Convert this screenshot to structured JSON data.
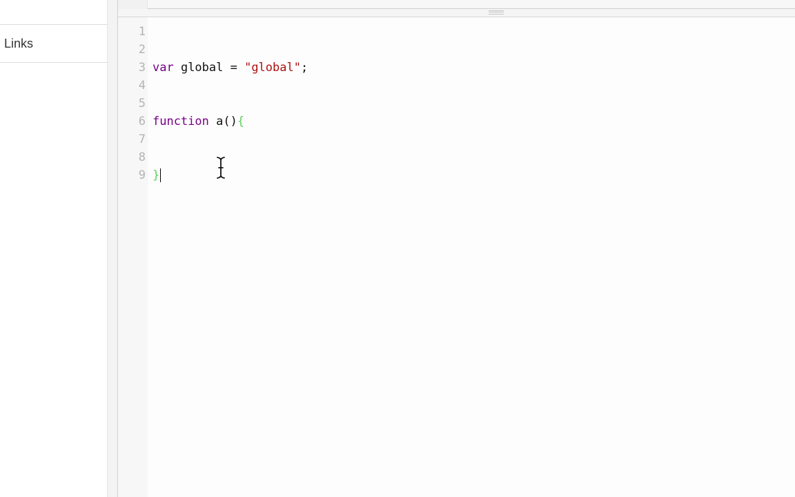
{
  "sidebar": {
    "items": [
      {
        "label": "Links"
      }
    ]
  },
  "editor": {
    "line_numbers": [
      "1",
      "2",
      "3",
      "4",
      "5",
      "6",
      "7",
      "8",
      "9"
    ],
    "line3": {
      "keyword": "var",
      "ident": " global = ",
      "string": "\"global\"",
      "end": ";"
    },
    "line6": {
      "keyword": "function",
      "ident": " a()",
      "brace": "{"
    },
    "line9": {
      "brace": "}"
    }
  },
  "colors": {
    "keyword": "#770088",
    "string": "#aa1111",
    "brace": "#5fcf5f",
    "line_number": "#b3b3b3"
  },
  "icons": {
    "cursor": "text-ibeam-cursor-icon",
    "splitter": "drag-handle-icon"
  }
}
